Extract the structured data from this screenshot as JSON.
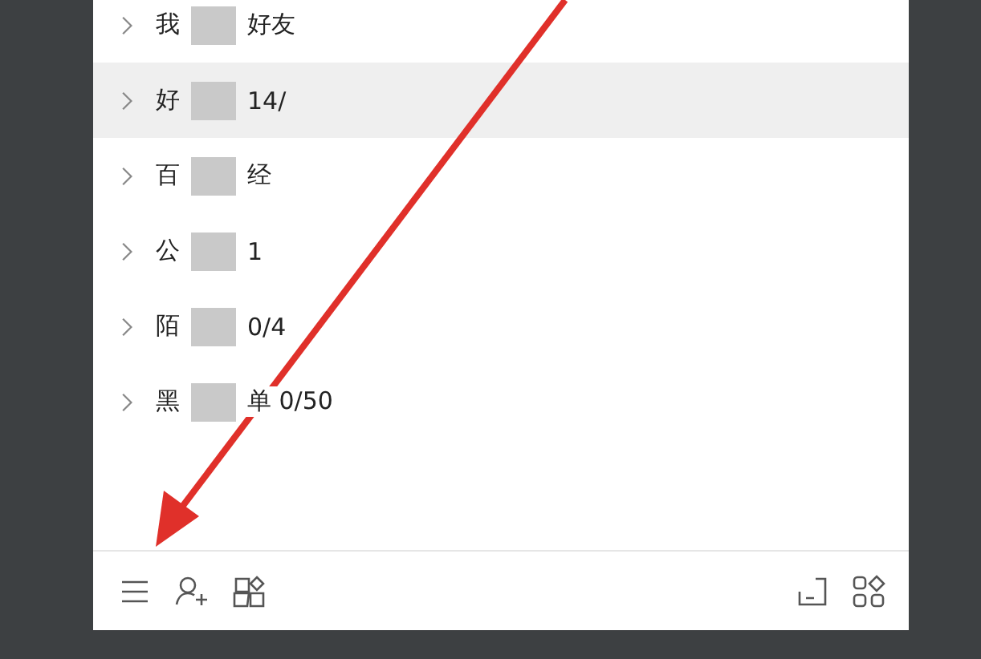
{
  "groups": [
    {
      "name": "我",
      "after": "好友",
      "expanded": false,
      "selected": false
    },
    {
      "name": "好",
      "after": "14/",
      "expanded": false,
      "selected": true
    },
    {
      "name": "百",
      "after": "经",
      "expanded": false,
      "selected": false
    },
    {
      "name": "公",
      "after": "1",
      "expanded": false,
      "selected": false
    },
    {
      "name": "陌",
      "after": "0/4",
      "expanded": false,
      "selected": false
    },
    {
      "name": "黑",
      "after": "单 0/50",
      "expanded": false,
      "selected": false
    }
  ]
}
